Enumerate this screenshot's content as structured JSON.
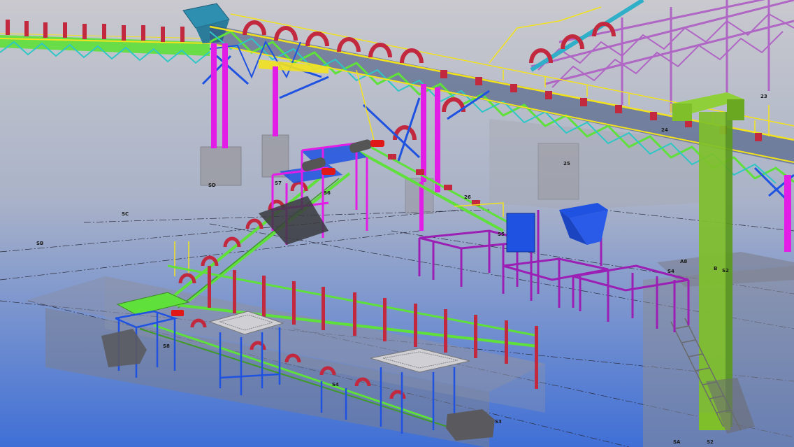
{
  "colors": {
    "background_top": "#c9c9ce",
    "background_bottom": "#3f6fd6",
    "column_magenta": "#e21ee6",
    "truss_green": "#5fe03a",
    "truss_cyan": "#2fc6c6",
    "truss_blue": "#1f52e0",
    "walkway_yellow": "#f2e21e",
    "idler_red": "#c2283e",
    "frame_purple": "#9b1fb4",
    "tower_green": "#7fbf2a",
    "gallery_mauve": "#b066c4",
    "concrete": "#9a9aa2"
  },
  "labels": {
    "sd": "SD",
    "s7": "S7",
    "s6": "S6",
    "sc": "SC",
    "sb": "SB",
    "s5": "S5",
    "s8": "S8",
    "s4": "S4",
    "s3": "S3",
    "n25": "25",
    "n26": "26",
    "n24": "24",
    "n23": "23",
    "a8": "A8",
    "b": "B",
    "s2": "S2",
    "s4b": "S4",
    "sa": "SA",
    "s2b": "S2"
  }
}
